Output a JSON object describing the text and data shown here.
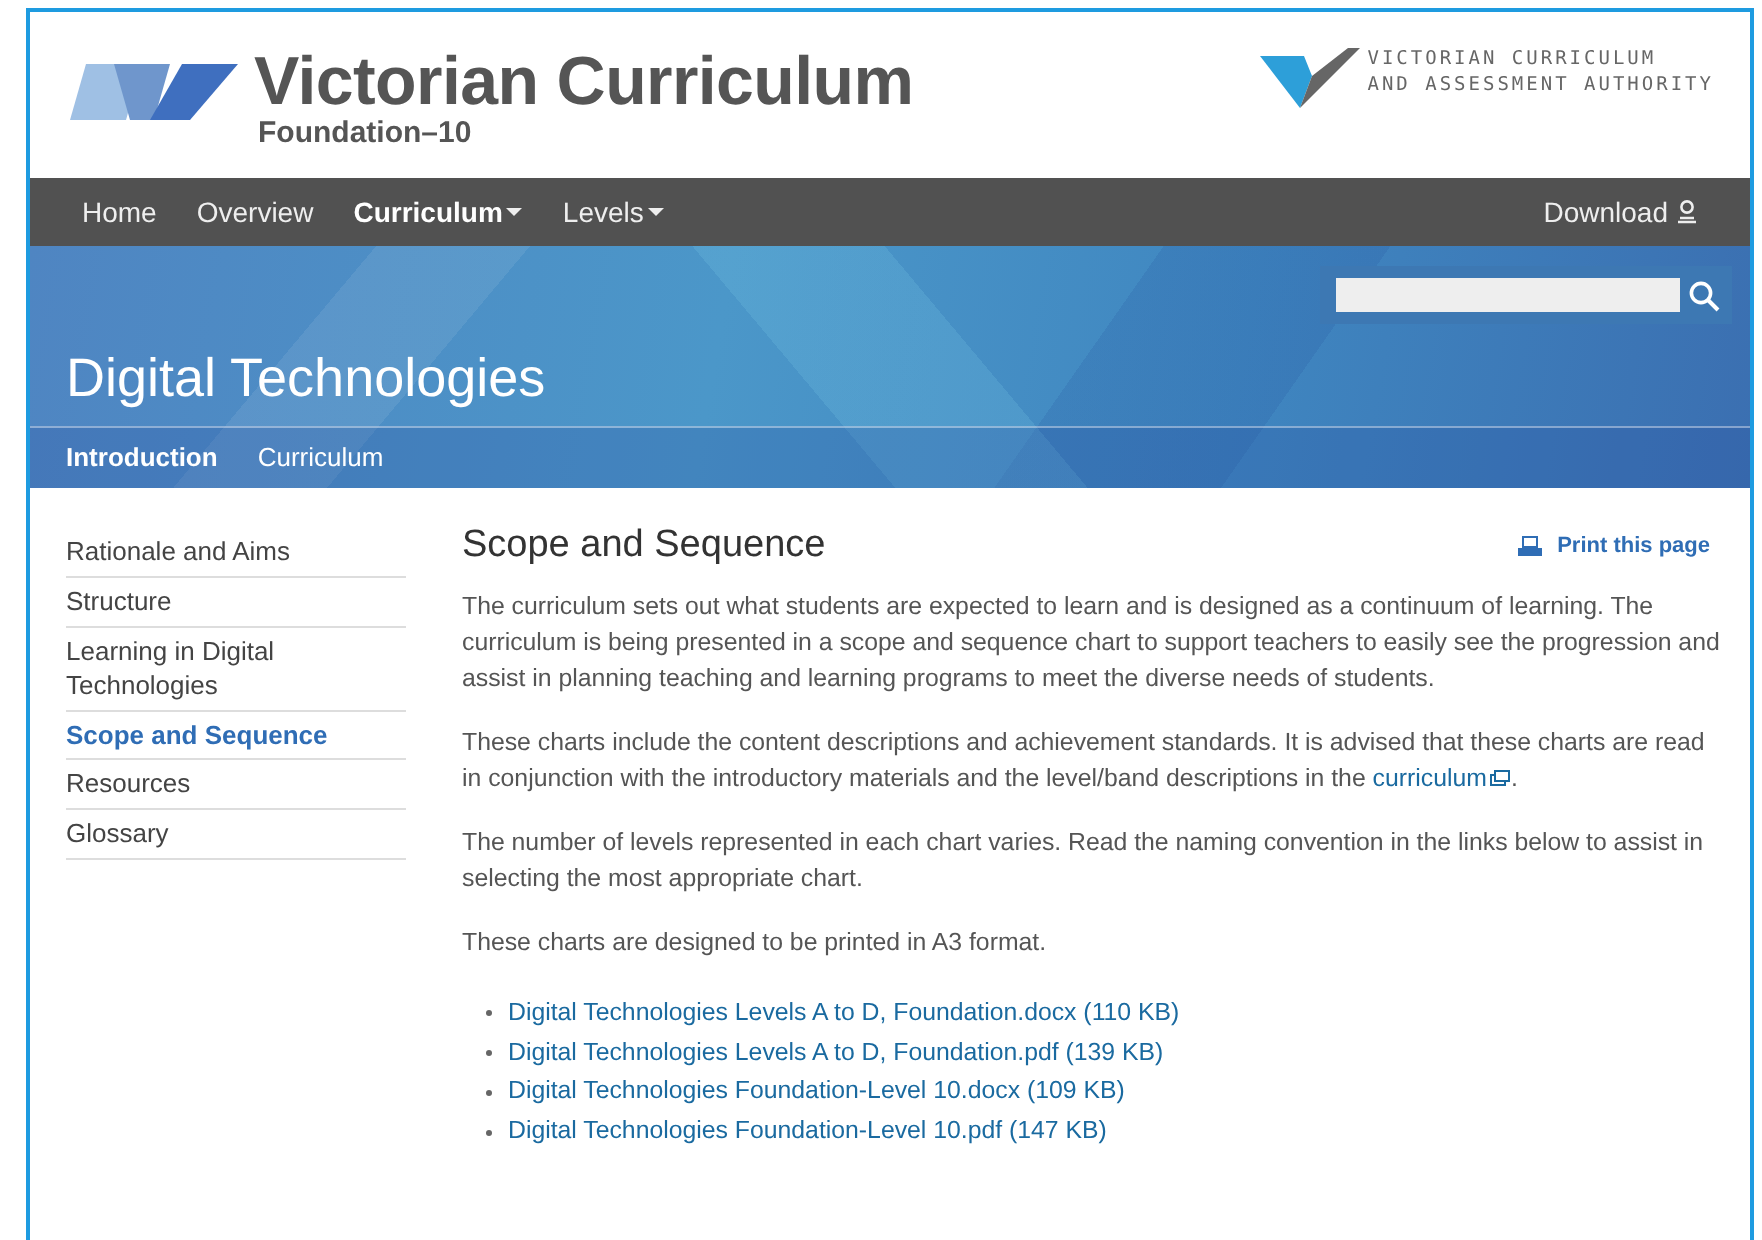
{
  "header": {
    "logo_title": "Victorian Curriculum",
    "logo_subtitle": "Foundation–10",
    "authority": [
      "VICTORIAN CURRICULUM",
      "AND ASSESSMENT AUTHORITY"
    ]
  },
  "nav": {
    "items": [
      {
        "label": "Home",
        "selected": false,
        "dropdown": false
      },
      {
        "label": "Overview",
        "selected": false,
        "dropdown": false
      },
      {
        "label": "Curriculum",
        "selected": true,
        "dropdown": true
      },
      {
        "label": "Levels",
        "selected": false,
        "dropdown": true
      }
    ],
    "download": "Download"
  },
  "banner": {
    "title": "Digital Technologies"
  },
  "subnav": [
    {
      "label": "Introduction",
      "selected": true
    },
    {
      "label": "Curriculum",
      "selected": false
    }
  ],
  "sidebar": [
    {
      "label": "Rationale and Aims",
      "selected": false
    },
    {
      "label": "Structure",
      "selected": false
    },
    {
      "label": "Learning in Digital Technologies",
      "selected": false
    },
    {
      "label": "Scope and Sequence",
      "selected": true
    },
    {
      "label": "Resources",
      "selected": false
    },
    {
      "label": "Glossary",
      "selected": false
    }
  ],
  "content": {
    "heading": "Scope and Sequence",
    "print": "Print this page",
    "paragraphs": [
      {
        "text": "The curriculum sets out what students are expected to learn and is designed as a continuum of learning. The curriculum is being presented in a scope and sequence chart to support teachers to easily see the progression and assist in planning teaching and learning programs to meet the diverse needs of students."
      },
      {
        "text": "These charts include the content descriptions and achievement standards. It is advised that these charts are read in conjunction with the introductory materials and the level/band descriptions in the ",
        "link": "curriculum",
        "after": "."
      },
      {
        "text": "The number of levels represented in each chart varies. Read the naming convention in the links below to assist in selecting the most appropriate chart."
      },
      {
        "text": "These charts are designed to be printed in A3 format."
      }
    ],
    "files": [
      "Digital Technologies Levels A to D, Foundation.docx (110 KB)",
      "Digital Technologies Levels A to D, Foundation.pdf (139 KB)",
      "Digital Technologies Foundation-Level 10.docx (109 KB)",
      "Digital Technologies Foundation-Level 10.pdf (147 KB)"
    ]
  }
}
